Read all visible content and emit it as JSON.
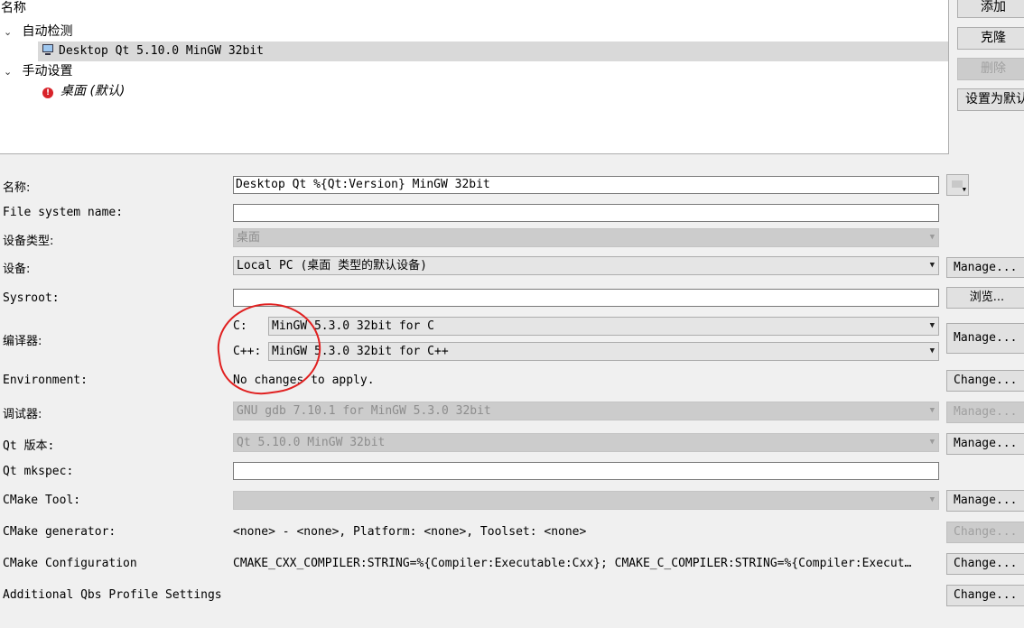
{
  "tree": {
    "header": "名称",
    "groups": [
      {
        "label": "自动检测",
        "items": [
          "Desktop Qt 5.10.0 MinGW 32bit"
        ]
      },
      {
        "label": "手动设置",
        "items": [
          "桌面 (默认)"
        ]
      }
    ]
  },
  "side_buttons": {
    "add": "添加",
    "clone": "克隆",
    "remove": "删除",
    "make_default": "设置为默认"
  },
  "form": {
    "name": {
      "label": "名称:",
      "value": "Desktop Qt %{Qt:Version} MinGW 32bit"
    },
    "fs_name": {
      "label": "File system name:",
      "value": ""
    },
    "device_type": {
      "label": "设备类型:",
      "value": "桌面"
    },
    "device": {
      "label": "设备:",
      "value": "Local PC (桌面 类型的默认设备)",
      "button": "Manage..."
    },
    "sysroot": {
      "label": "Sysroot:",
      "value": "",
      "button": "浏览..."
    },
    "compiler": {
      "label": "编译器:",
      "c_label": "C:",
      "c_value": "MinGW 5.3.0 32bit for C",
      "cxx_label": "C++:",
      "cxx_value": "MinGW 5.3.0 32bit for C++",
      "button": "Manage..."
    },
    "environment": {
      "label": "Environment:",
      "value": "No changes to apply.",
      "button": "Change..."
    },
    "debugger": {
      "label": "调试器:",
      "value": "GNU gdb 7.10.1 for MinGW 5.3.0 32bit",
      "button": "Manage..."
    },
    "qt_version": {
      "label": "Qt 版本:",
      "value": "Qt 5.10.0 MinGW 32bit",
      "button": "Manage..."
    },
    "mkspec": {
      "label": "Qt mkspec:",
      "value": ""
    },
    "cmake_tool": {
      "label": "CMake Tool:",
      "value": "",
      "button": "Manage..."
    },
    "cmake_generator": {
      "label": "CMake generator:",
      "value": "<none> - <none>, Platform: <none>, Toolset: <none>",
      "button": "Change..."
    },
    "cmake_config": {
      "label": "CMake Configuration",
      "value": "CMAKE_CXX_COMPILER:STRING=%{Compiler:Executable:Cxx}; CMAKE_C_COMPILER:STRING=%{Compiler:Execut…",
      "button": "Change..."
    },
    "qbs": {
      "label": "Additional Qbs Profile Settings",
      "button": "Change..."
    }
  },
  "icons": {
    "kit_icon": "monitor-icon",
    "warning_icon": "error-icon",
    "annotation_color": "#e02020"
  }
}
